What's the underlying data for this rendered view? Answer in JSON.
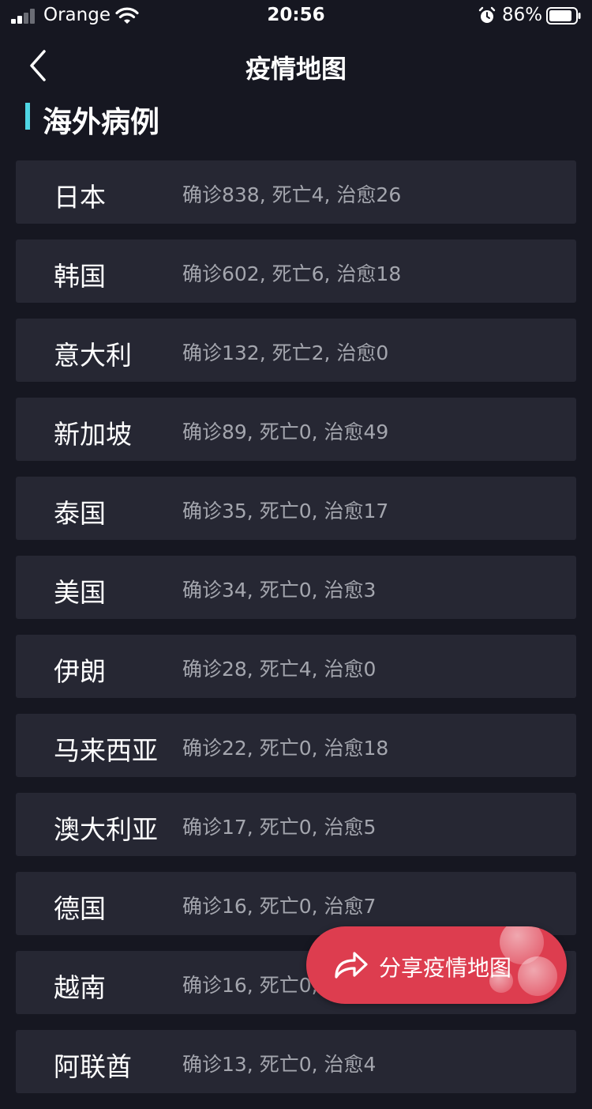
{
  "status_bar": {
    "carrier": "Orange",
    "time": "20:56",
    "battery_percent": "86%"
  },
  "nav": {
    "title": "疫情地图",
    "back_icon": "chevron-left-icon"
  },
  "section": {
    "title": "海外病例"
  },
  "countries": [
    {
      "name": "日本",
      "stats": "确诊838, 死亡4, 治愈26"
    },
    {
      "name": "韩国",
      "stats": "确诊602, 死亡6, 治愈18"
    },
    {
      "name": "意大利",
      "stats": "确诊132, 死亡2, 治愈0"
    },
    {
      "name": "新加坡",
      "stats": "确诊89, 死亡0, 治愈49"
    },
    {
      "name": "泰国",
      "stats": "确诊35, 死亡0, 治愈17"
    },
    {
      "name": "美国",
      "stats": "确诊34, 死亡0, 治愈3"
    },
    {
      "name": "伊朗",
      "stats": "确诊28, 死亡4, 治愈0"
    },
    {
      "name": "马来西亚",
      "stats": "确诊22, 死亡0, 治愈18"
    },
    {
      "name": "澳大利亚",
      "stats": "确诊17, 死亡0, 治愈5"
    },
    {
      "name": "德国",
      "stats": "确诊16, 死亡0, 治愈7"
    },
    {
      "name": "越南",
      "stats": "确诊16, 死亡0,"
    },
    {
      "name": "阿联酋",
      "stats": "确诊13, 死亡0, 治愈4"
    }
  ],
  "share": {
    "label": "分享疫情地图",
    "icon": "share-arrow-icon"
  },
  "colors": {
    "background": "#161721",
    "card": "#262733",
    "accent": "#4fd6e4",
    "share_button": "#dd3d4f",
    "stats_text": "#a4a6ae"
  }
}
